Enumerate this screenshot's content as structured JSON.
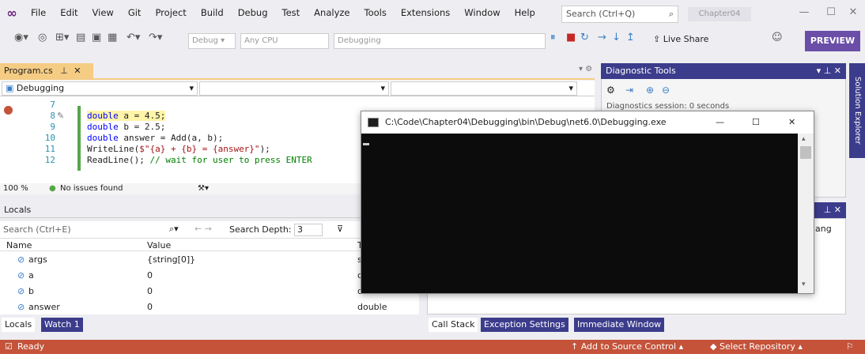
{
  "menubar": {
    "items": [
      "File",
      "Edit",
      "View",
      "Git",
      "Project",
      "Build",
      "Debug",
      "Test",
      "Analyze",
      "Tools",
      "Extensions",
      "Window",
      "Help"
    ],
    "search_placeholder": "Search (Ctrl+Q)",
    "solution_name": "Chapter04"
  },
  "toolbar": {
    "config": "Debug",
    "platform": "Any CPU",
    "startup": "Debugging",
    "live_share": "Live Share",
    "preview": "PREVIEW"
  },
  "editor": {
    "tab_label": "Program.cs",
    "project_combo": "Debugging",
    "lines": [
      {
        "num": "7"
      },
      {
        "num": "8"
      },
      {
        "num": "9"
      },
      {
        "num": "10"
      },
      {
        "num": "11"
      },
      {
        "num": "12"
      }
    ],
    "zoom": "100 %",
    "issues": "No issues found"
  },
  "locals": {
    "title": "Locals",
    "search_placeholder": "Search (Ctrl+E)",
    "search_depth_label": "Search Depth:",
    "search_depth_value": "3",
    "col_name": "Name",
    "col_value": "Value",
    "col_type": "Typ",
    "rows": [
      {
        "name": "args",
        "value": "{string[0]}",
        "type": "stri"
      },
      {
        "name": "a",
        "value": "0",
        "type": "dou"
      },
      {
        "name": "b",
        "value": "0",
        "type": "double"
      },
      {
        "name": "answer",
        "value": "0",
        "type": "double"
      }
    ]
  },
  "bottom_tabs_left": [
    "Locals",
    "Watch 1"
  ],
  "bottom_tabs_right": [
    "Call Stack",
    "Exception Settings",
    "Immediate Window"
  ],
  "diagnostic": {
    "title": "Diagnostic Tools",
    "session_text": "Diagnostics session: 0 seconds"
  },
  "solution_explorer_label": "Solution Explorer",
  "right_lower_partial": "ang",
  "console": {
    "title": "C:\\Code\\Chapter04\\Debugging\\bin\\Debug\\net6.0\\Debugging.exe"
  },
  "statusbar": {
    "ready": "Ready",
    "add_source": "Add to Source Control",
    "select_repo": "Select Repository"
  },
  "colors": {
    "statusbar": "#c4533a",
    "console_bg": "#0c0c0c",
    "preview": "#6b4ea8",
    "tab_highlight": "#f5cc84"
  }
}
